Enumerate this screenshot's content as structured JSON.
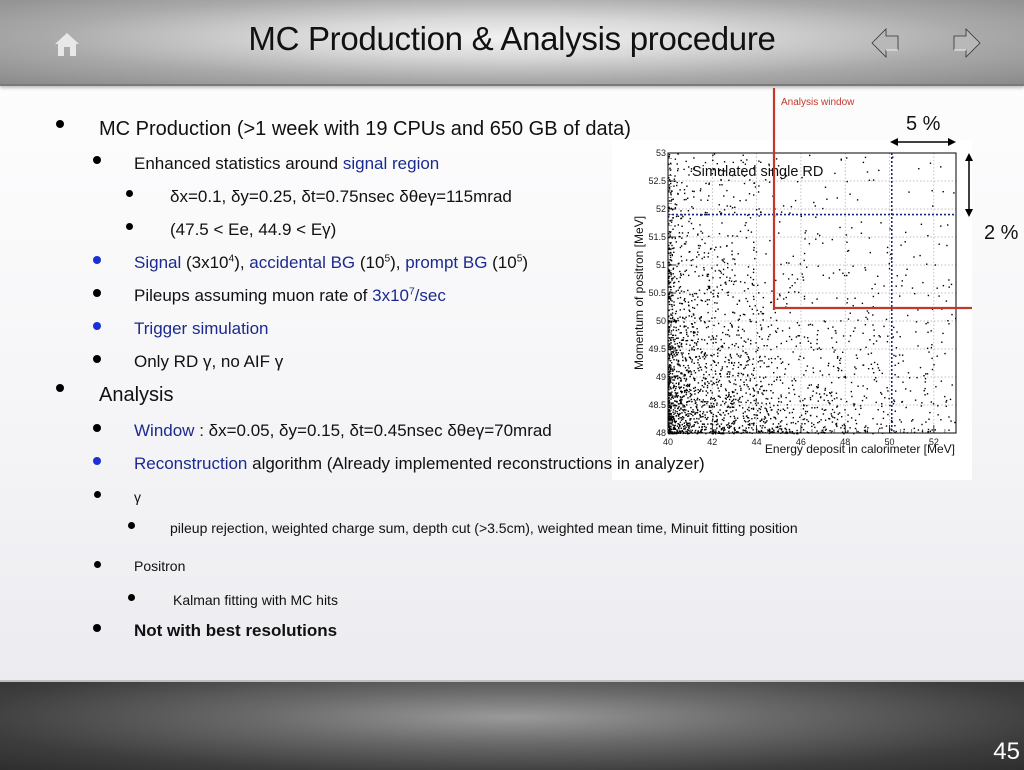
{
  "header": {
    "title": "MC Production & Analysis procedure",
    "icons": {
      "home": "home-icon",
      "prev": "arrow-left-icon",
      "next": "arrow-right-icon"
    }
  },
  "bullets": {
    "mc_production": "MC Production (>1 week with 19 CPUs and 650 GB of data)",
    "enhanced_prefix": "Enhanced statistics around ",
    "enhanced_link": "signal region",
    "delta_window": "δx=0.1, δy=0.25, δt=0.75nsec δθeγ=115mrad",
    "energy_cut": "(47.5 < Ee, 44.9 < Eγ)",
    "signal_label": "Signal",
    "signal_count_base": " (3x10",
    "signal_count_exp": "4",
    "signal_count_end": "), ",
    "accidental_label": "accidental BG",
    "accidental_base": " (10",
    "accidental_exp": "5",
    "accidental_end": "), ",
    "prompt_label": "prompt BG",
    "prompt_base": " (10",
    "prompt_exp": "5",
    "prompt_end": ")",
    "pileups_prefix": "Pileups assuming muon rate of ",
    "pileups_rate_base": "3x10",
    "pileups_rate_exp": "7",
    "pileups_rate_end": "/sec",
    "trigger": "Trigger simulation",
    "only_rd": "Only RD γ, no AIF γ",
    "analysis": "Analysis",
    "window_label": "Window",
    "window_values": " : δx=0.05, δy=0.15, δt=0.45nsec δθeγ=70mrad",
    "reconstruction_label": "Reconstruction",
    "reconstruction_rest": " algorithm (Already implemented reconstructions in analyzer)",
    "gamma": "γ",
    "gamma_details": "pileup rejection, weighted charge sum, depth cut (>3.5cm),  weighted mean time, Minuit fitting position",
    "positron": "Positron",
    "positron_details": "Kalman fitting with MC hits",
    "not_best": "Not with best resolutions"
  },
  "annotations": {
    "analysis_window": "Analysis window",
    "pct_x": "5 %",
    "pct_y": "2 %"
  },
  "footer": {
    "page_number": "45"
  },
  "colors": {
    "link_blue": "#1b2a8f",
    "bullet_blue": "#1a2fd6",
    "window_red": "#c0392b",
    "dotted_navy": "#1a237e"
  },
  "chart_data": {
    "type": "scatter",
    "title": "Simulated single RD",
    "xlabel": "Energy deposit in calorimeter [MeV]",
    "ylabel": "Momentum of positron [MeV]",
    "xlim": [
      40,
      53
    ],
    "ylim": [
      48,
      53
    ],
    "x_ticks": [
      "40",
      "42",
      "44",
      "46",
      "48",
      "50",
      "52"
    ],
    "y_ticks": [
      "48",
      "48.5",
      "49",
      "49.5",
      "50",
      "50.5",
      "51",
      "51.5",
      "52",
      "52.5",
      "53"
    ],
    "grid": true,
    "density_note": "points densest at low energy / low momentum, thinning toward upper right",
    "reference_lines": {
      "x_dotted": 50.1,
      "y_dotted": 51.9
    },
    "analysis_window": {
      "x_min": 44.9,
      "y_min": 50.2
    },
    "approx_point_count": 2500
  }
}
